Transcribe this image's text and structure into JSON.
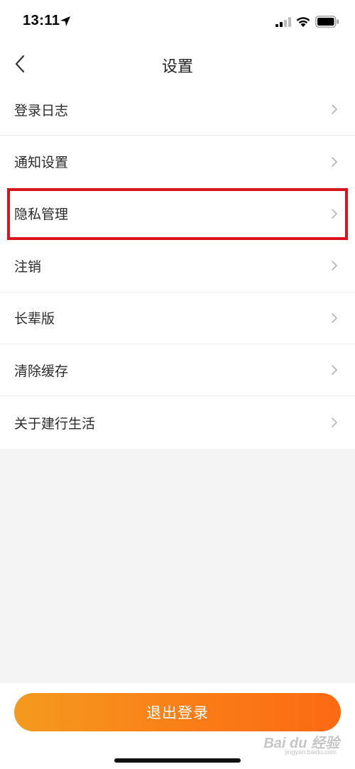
{
  "status_bar": {
    "time": "13:11",
    "icons": [
      "location-arrow-icon",
      "signal-icon",
      "wifi-icon",
      "battery-icon"
    ]
  },
  "nav": {
    "title": "设置",
    "back_icon": "chevron-left-icon"
  },
  "settings": {
    "items": [
      {
        "label": "登录日志"
      },
      {
        "label": "通知设置"
      },
      {
        "label": "隐私管理",
        "highlighted": true
      },
      {
        "label": "注销"
      },
      {
        "label": "长辈版"
      },
      {
        "label": "清除缓存"
      },
      {
        "label": "关于建行生活"
      }
    ]
  },
  "footer": {
    "logout_label": "退出登录"
  },
  "watermark": {
    "brand": "Bai du 经验",
    "url": "jingyan.baidu.com"
  },
  "colors": {
    "accent_start": "#f59a1e",
    "accent_end": "#fb6a13",
    "highlight_border": "#d9141e",
    "background": "#f4f4f4"
  }
}
